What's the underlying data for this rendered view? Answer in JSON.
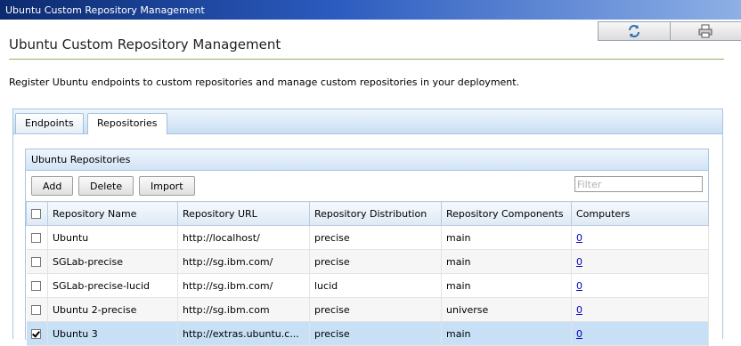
{
  "window": {
    "title": "Ubuntu Custom Repository Management"
  },
  "toolbar": {
    "buttons": [
      {
        "icon": "refresh-icon"
      },
      {
        "icon": "print-icon"
      }
    ]
  },
  "page": {
    "title": "Ubuntu Custom Repository Management",
    "description": "Register Ubuntu endpoints to custom repositories and manage custom repositories in your deployment."
  },
  "tabs": [
    {
      "label": "Endpoints"
    },
    {
      "label": "Repositories",
      "selected": true
    }
  ],
  "section": {
    "title": "Ubuntu Repositories",
    "buttons": {
      "add": "Add",
      "delete": "Delete",
      "import": "Import"
    },
    "filter": {
      "placeholder": "Filter",
      "value": ""
    }
  },
  "table": {
    "columns": [
      "Repository Name",
      "Repository URL",
      "Repository Distribution",
      "Repository Components",
      "Computers"
    ],
    "rows": [
      {
        "checked": false,
        "name": "Ubuntu",
        "url": "http://localhost/",
        "distribution": "precise",
        "components": "main",
        "computers": "0"
      },
      {
        "checked": false,
        "name": "SGLab-precise",
        "url": "http://sg.ibm.com/",
        "distribution": "precise",
        "components": "main",
        "computers": "0"
      },
      {
        "checked": false,
        "name": "SGLab-precise-lucid",
        "url": "http://sg.ibm.com/",
        "distribution": "lucid",
        "components": "main",
        "computers": "0"
      },
      {
        "checked": false,
        "name": "Ubuntu 2-precise",
        "url": "http://sg.ibm.com",
        "distribution": "precise",
        "components": "universe",
        "computers": "0"
      },
      {
        "checked": true,
        "name": "Ubuntu 3",
        "url": "http://extras.ubuntu.c...",
        "distribution": "precise",
        "components": "main",
        "computers": "0"
      }
    ]
  },
  "colors": {
    "titlebar": "#0c2a6e",
    "accent_rule": "#8cb45a",
    "selected_row": "#c7e0f5",
    "link": "#0000c0"
  }
}
